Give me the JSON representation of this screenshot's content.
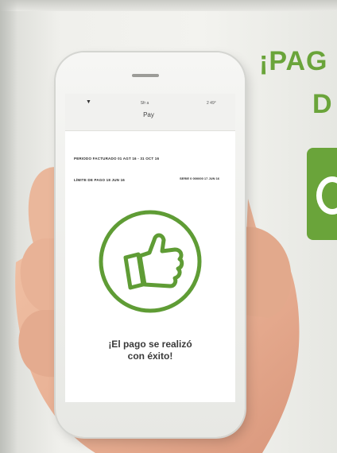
{
  "poster": {
    "headline_line1": "¡PAG",
    "headline_line2": "D",
    "accent_color": "#6aa43a"
  },
  "phone": {
    "status": {
      "signal": "▼",
      "carrier": "Sfr a",
      "battery": "2 49°"
    },
    "nav_title": "Pay",
    "info": {
      "row1": "PERIODO FACTURADO 01 AGT 16 - 31 OCT 16",
      "row2": "LÍMITE DE PAGO 18 JUN 16",
      "side": "SERIE 0 000000 17 JUN 16"
    },
    "success_message_line1": "¡El pago se realizó",
    "success_message_line2": "con éxito!",
    "icon": "thumbs-up-icon"
  }
}
